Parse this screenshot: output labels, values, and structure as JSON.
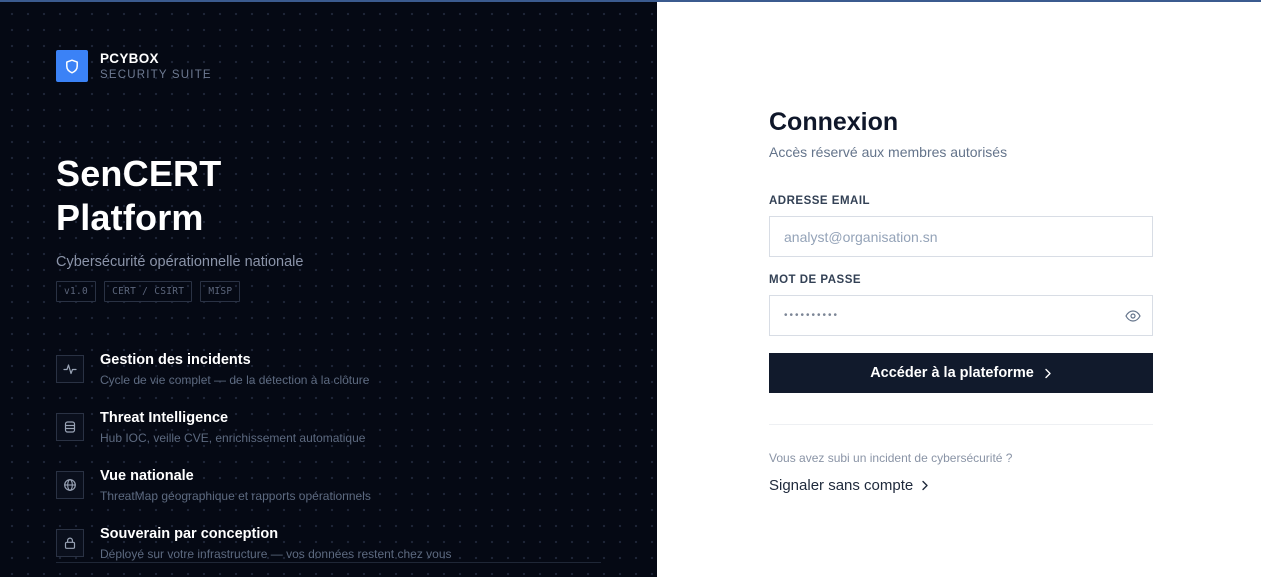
{
  "brand": {
    "name": "PCYBOX",
    "tagline": "SECURITY SUITE"
  },
  "hero": {
    "title_line1": "SenCERT",
    "title_line2": "Platform",
    "subtitle": "Cybersécurité opérationnelle nationale",
    "tags": [
      "v1.0",
      "CERT / CSIRT",
      "MISP"
    ]
  },
  "features": [
    {
      "icon": "activity-icon",
      "title": "Gestion des incidents",
      "description": "Cycle de vie complet — de la détection à la clôture"
    },
    {
      "icon": "database-icon",
      "title": "Threat Intelligence",
      "description": "Hub IOC, veille CVE, enrichissement automatique"
    },
    {
      "icon": "globe-icon",
      "title": "Vue nationale",
      "description": "ThreatMap géographique et rapports opérationnels"
    },
    {
      "icon": "lock-icon",
      "title": "Souverain par conception",
      "description": "Déployé sur votre infrastructure — vos données restent chez vous"
    }
  ],
  "login": {
    "title": "Connexion",
    "subtitle": "Accès réservé aux membres autorisés",
    "email_label": "ADRESSE EMAIL",
    "email_placeholder": "analyst@organisation.sn",
    "email_value": "",
    "password_label": "MOT DE PASSE",
    "password_masked": "••••••••••",
    "submit_label": "Accéder à la plateforme",
    "incident_question": "Vous avez subi un incident de cybersécurité ?",
    "report_label": "Signaler sans compte"
  },
  "colors": {
    "left_bg": "#050914",
    "brand_accent": "#3b82f6",
    "button_bg": "#111a2c"
  }
}
